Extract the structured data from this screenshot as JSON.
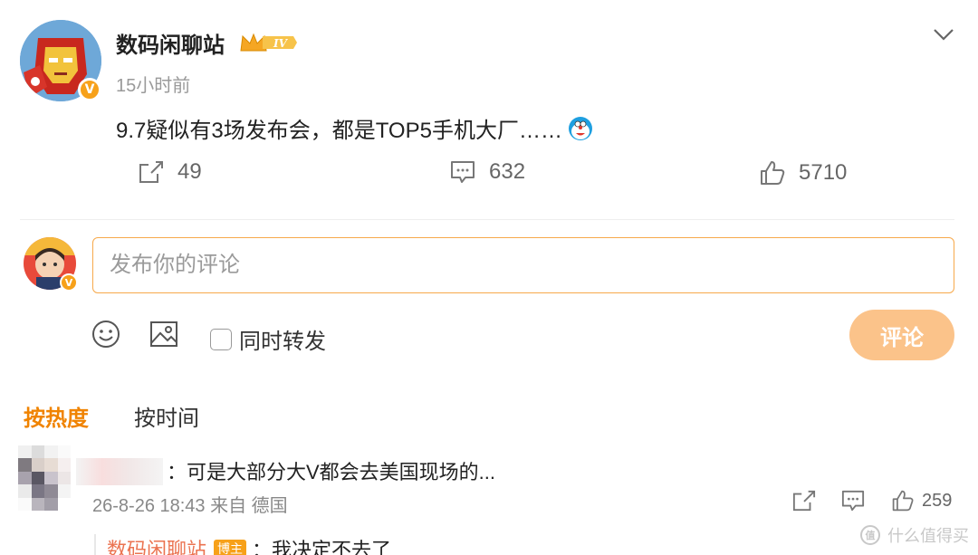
{
  "post": {
    "author": "数码闲聊站",
    "level_badge": "IV",
    "time": "15小时前",
    "content": "9.7疑似有3场发布会，都是TOP5手机大厂……",
    "repost_count": "49",
    "comment_count": "632",
    "like_count": "5710",
    "avatar_icon": "iron-man-avatar",
    "verified_badge": "V"
  },
  "composer": {
    "placeholder": "发布你的评论",
    "repost_label": "同时转发",
    "submit_label": "评论"
  },
  "sort": {
    "hot_label": "按热度",
    "time_label": "按时间"
  },
  "comments": [
    {
      "text": "：可是大部分大V都会去美国现场的...",
      "meta": "26-8-26 18:43 来自 德国",
      "like_count": "259",
      "replies": [
        {
          "author": "数码闲聊站",
          "badge": "博主",
          "text": "：我决定不去了"
        }
      ]
    }
  ],
  "watermark": "什么值得买",
  "colors": {
    "accent": "#f08300",
    "input_border": "#f7a94b",
    "submit_bg": "#fbc38a",
    "reply_name": "#eb7350",
    "verified": "#f7a11a"
  }
}
